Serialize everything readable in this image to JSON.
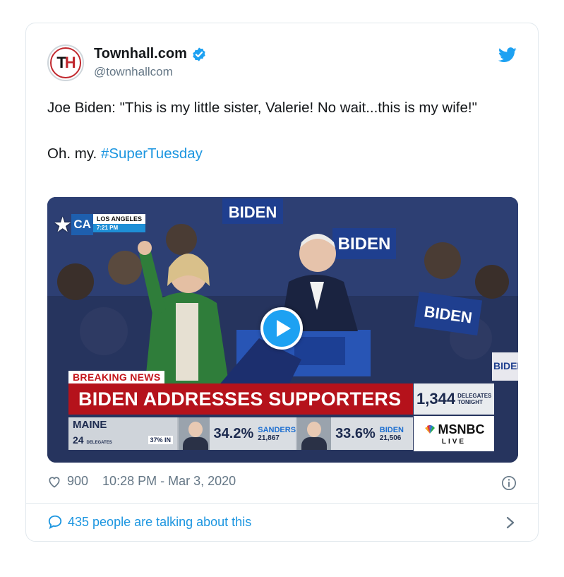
{
  "account": {
    "avatar_letters": "TH",
    "display_name": "Townhall.com",
    "handle": "@townhallcom",
    "verified": true
  },
  "tweet": {
    "line1": "Joe Biden: \"This is my little sister, Valerie! No wait...this is my wife!\"",
    "line2_prefix": "Oh. my. ",
    "hashtag": "#SuperTuesday"
  },
  "video": {
    "location_state": "CA",
    "location_city": "LOS ANGELES",
    "location_time": "7:21 PM",
    "breaking_label": "BREAKING NEWS",
    "headline": "BIDEN ADDRESSES SUPPORTERS",
    "delegates_count": "1,344",
    "delegates_label_1": "DELEGATES",
    "delegates_label_2": "TONIGHT",
    "network": "MSNBC",
    "network_status": "LIVE",
    "state_name": "MAINE",
    "state_delegates": "24",
    "state_delegates_label": "DELEGATES",
    "state_reporting": "37% IN",
    "candidates": [
      {
        "pct": "34.2%",
        "name": "SANDERS",
        "votes": "21,867"
      },
      {
        "pct": "33.6%",
        "name": "BIDEN",
        "votes": "21,506"
      }
    ],
    "signs": [
      "BIDEN",
      "BIDEN",
      "BIDEN",
      "BIDEN"
    ]
  },
  "meta": {
    "likes": "900",
    "timestamp": "10:28 PM - Mar 3, 2020"
  },
  "footer": {
    "talking": "435 people are talking about this"
  },
  "colors": {
    "accent": "#1b95e0",
    "muted": "#657786",
    "verified": "#1da1f2",
    "breaking_red": "#b5121b"
  }
}
